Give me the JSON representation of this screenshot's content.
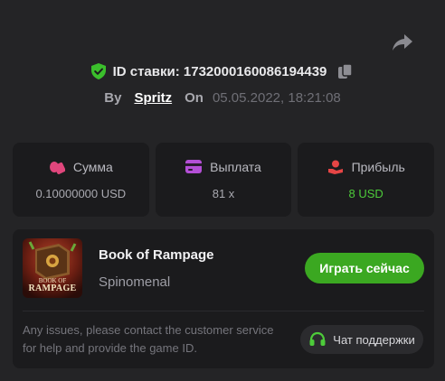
{
  "header": {
    "bet_id_label": "ID ставки: 1732000160086194439",
    "by_label": "By",
    "username": "Spritz",
    "on_label": "On",
    "date": "05.05.2022, 18:21:08"
  },
  "stats": [
    {
      "label": "Сумма",
      "value": "0.10000000 USD",
      "icon": "chips-icon",
      "color": "#e0467c"
    },
    {
      "label": "Выплата",
      "value": "81 x",
      "icon": "wallet-icon",
      "color": "#b44fd6"
    },
    {
      "label": "Прибыль",
      "value": "8 USD",
      "icon": "profit-hand-icon",
      "color": "#e64545"
    }
  ],
  "game": {
    "thumbnail_text_small": "BOOK OF",
    "thumbnail_text_big": "RAMPAGE",
    "title": "Book of Rampage",
    "provider": "Spinomenal",
    "play_label": "Играть сейчас",
    "notice": "Any issues, please contact the customer service for help and provide the game ID.",
    "support_label": "Чат поддержки"
  },
  "colors": {
    "background": "#242426",
    "card": "#1b1b1d",
    "accent_green": "#3ba821",
    "profit_green": "#4dcb3a"
  }
}
